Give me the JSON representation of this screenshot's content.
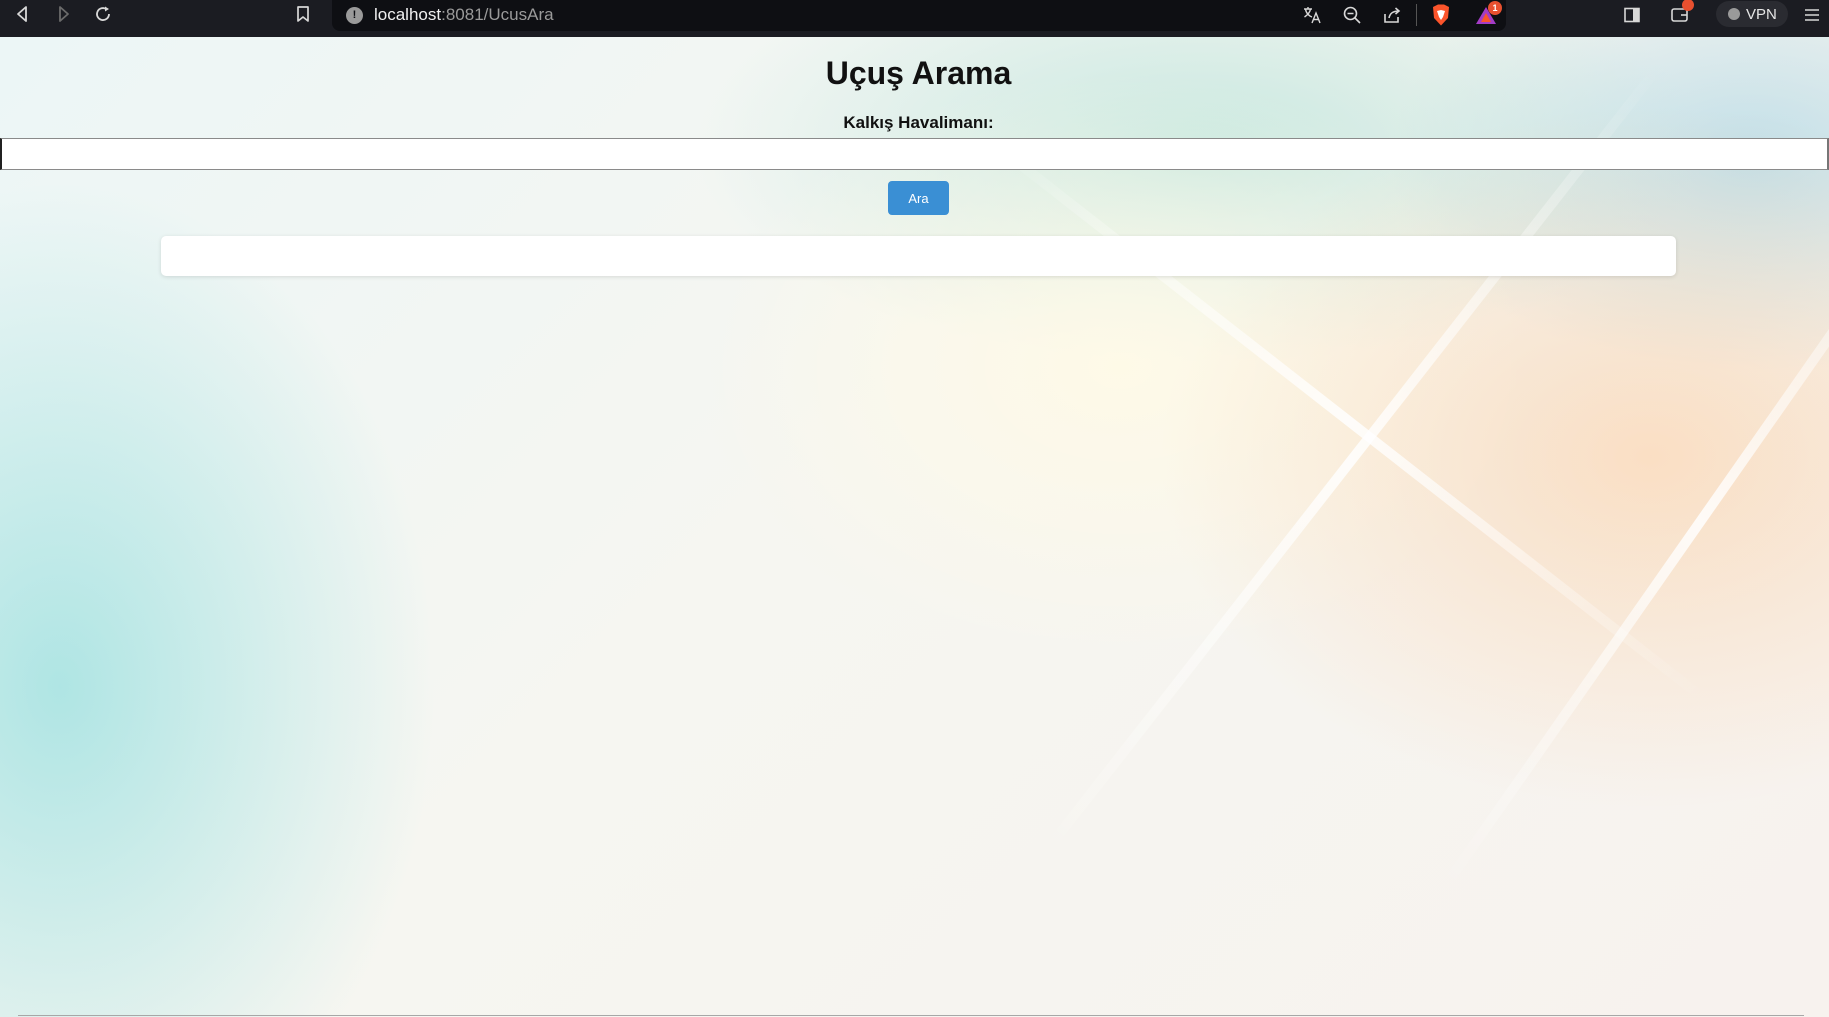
{
  "browser": {
    "url_host": "localhost",
    "url_path": ":8081/UcusAra",
    "icons": [
      "back-icon",
      "forward-icon",
      "reload-icon",
      "bookmark-icon",
      "site-info-icon",
      "translate-icon",
      "zoom-out-icon",
      "share-icon",
      "brave-shields-icon",
      "brave-rewards-icon",
      "sidebar-icon",
      "wallet-icon",
      "menu-icon"
    ],
    "rewards_badge": "1",
    "vpn_label": "VPN"
  },
  "page": {
    "title": "Uçuş Arama",
    "field_label": "Kalkış Havalimanı:",
    "airport_value": "",
    "search_button_label": "Ara"
  },
  "colors": {
    "chrome_bg": "#1b1c22",
    "button_bg": "#3a8fd4",
    "brave_orange": "#fb542b"
  }
}
